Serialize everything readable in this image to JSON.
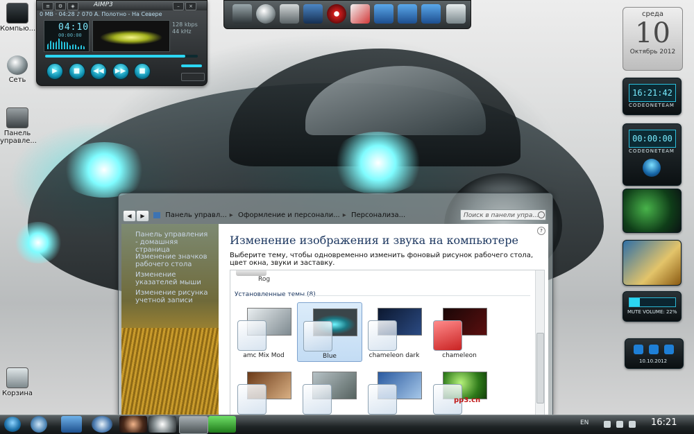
{
  "desktop_icons": [
    {
      "label": "Компью...",
      "icon": "computer-icon"
    },
    {
      "label": "Сеть",
      "icon": "network-icon"
    },
    {
      "label": "Панель управле...",
      "icon": "control-panel-icon"
    },
    {
      "label": "Корзина",
      "icon": "recycle-bin-icon"
    }
  ],
  "aimp": {
    "logo": "AIMP3",
    "info": "0 MB  ·  04:28 ♪ 070 А. Полотно - На Севере",
    "time": "04:10",
    "time_sub": "00:00:00",
    "kbps": "128 kbps",
    "khz": "44 kHz",
    "seek_percent": 92,
    "controls": [
      "▶",
      "■",
      "◀◀",
      "▶▶",
      "■"
    ]
  },
  "dock": {
    "icons": [
      "computer-icon",
      "globe-icon",
      "settings-icon",
      "joystick-icon",
      "media-icon",
      "css-icon",
      "folder-icon",
      "music-folder-icon",
      "pictures-folder-icon",
      "recycle-bin-icon"
    ]
  },
  "calendar": {
    "weekday": "среда",
    "day": "10",
    "month_year": "Октябрь 2012"
  },
  "gadgets": {
    "clock_time": "16:21:42",
    "clock_brand": "CODEONETEAM",
    "timer_time": "00:00:00",
    "timer_brand": "CODEONETEAM",
    "mute_label": "MUTE VOLUME: 22%",
    "volume_percent": 22,
    "date_small": "10.10.2012"
  },
  "window": {
    "breadcrumbs": [
      "Панель управл...",
      "Оформление и персонали...",
      "Персонализа..."
    ],
    "search_placeholder": "Поиск в панели упра...",
    "left_links": [
      "Панель управления - домашняя страница",
      "Изменение значков рабочего стола",
      "Изменение указателей мыши",
      "Изменение рисунка учетной записи"
    ],
    "title": "Изменение изображения и звука на компьютере",
    "description": "Выберите тему, чтобы одновременно изменить фоновый рисунок рабочего стола, цвет окна, звуки и заставку.",
    "rog_label": "Rog",
    "installed_section": "Установленные темы (8)",
    "themes": [
      {
        "name": "amc Mix Mod"
      },
      {
        "name": "Blue",
        "selected": true
      },
      {
        "name": "chameleon dark"
      },
      {
        "name": "chameleon"
      },
      {
        "name": ""
      },
      {
        "name": ""
      },
      {
        "name": ""
      },
      {
        "name": "",
        "overlay": "pp3.cn"
      }
    ]
  },
  "taskbar": {
    "lang": "EN",
    "clock": "16:21"
  }
}
